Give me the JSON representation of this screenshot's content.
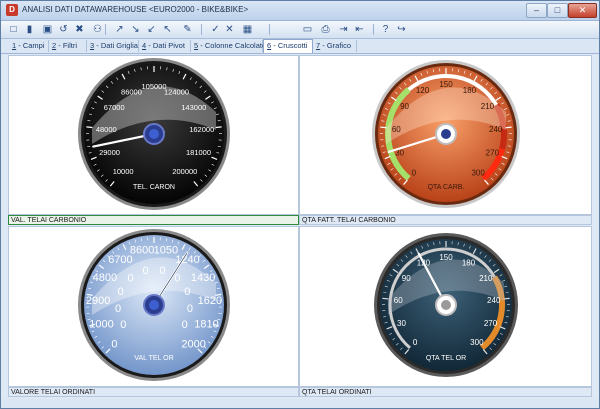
{
  "window": {
    "title": "ANALISI DATI DATAWAREHOUSE <EURO2000 - BIKE&BIKE>",
    "app_icon_glyph": "D"
  },
  "controls": {
    "minimize": "–",
    "maximize": "□",
    "close": "✕"
  },
  "toolbar": {
    "buttons": [
      {
        "name": "new-icon",
        "glyph": "□"
      },
      {
        "name": "open-icon",
        "glyph": "▮"
      },
      {
        "name": "save-icon",
        "glyph": "▣"
      },
      {
        "name": "undo-icon",
        "glyph": "↺"
      },
      {
        "name": "delete-icon",
        "glyph": "✖"
      },
      {
        "name": "find-icon",
        "glyph": "⚇"
      },
      {
        "name": "sort-asc-icon",
        "glyph": "↗"
      },
      {
        "name": "sort-desc-icon",
        "glyph": "↘"
      },
      {
        "name": "filter-icon",
        "glyph": "↙"
      },
      {
        "name": "arrow-icon",
        "glyph": "↖"
      },
      {
        "name": "edit-icon",
        "glyph": "✎"
      },
      {
        "name": "check-icon",
        "glyph": "✓"
      },
      {
        "name": "cross-icon",
        "glyph": "✕"
      },
      {
        "name": "layout-icon",
        "glyph": "▦"
      },
      {
        "name": "monitor-icon",
        "glyph": "▭"
      },
      {
        "name": "print-icon",
        "glyph": "⎙"
      },
      {
        "name": "export-icon",
        "glyph": "⇥"
      },
      {
        "name": "import-icon",
        "glyph": "⇤"
      },
      {
        "name": "help-icon",
        "glyph": "?"
      },
      {
        "name": "exit-icon",
        "glyph": "↪"
      }
    ]
  },
  "tabs": [
    {
      "num": "1",
      "label": " - Campi"
    },
    {
      "num": "2",
      "label": " - Filtri"
    },
    {
      "num": "3",
      "label": " - Dati Griglia"
    },
    {
      "num": "4",
      "label": " - Dati Pivot"
    },
    {
      "num": "5",
      "label": " - Colonne Calcolate"
    },
    {
      "num": "6",
      "label": " - Cruscotti"
    },
    {
      "num": "7",
      "label": " - Grafico"
    }
  ],
  "gauges": [
    {
      "caption": "VAL. TELAI CARBONIO",
      "unit_label": "TEL. CARON",
      "scale_labels": [
        "10000",
        "29000",
        "48000",
        "67000",
        "86000",
        "105000",
        "124000",
        "143000",
        "162000",
        "181000",
        "200000"
      ],
      "value": 36000,
      "min": 10000,
      "max": 200000
    },
    {
      "caption": "QTA FATT. TELAI CARBONIO",
      "unit_label": "QTA CARB.",
      "scale_labels": [
        "0",
        "30",
        "60",
        "90",
        "120",
        "150",
        "180",
        "210",
        "240",
        "270",
        "300"
      ],
      "value": 35,
      "min": 0,
      "max": 300
    },
    {
      "caption": "VALORE TELAI ORDINATI",
      "unit_label": "VAL TEL OR",
      "scale_labels": [
        "0",
        "1000",
        "2900",
        "4800",
        "6700",
        "8600",
        "1050",
        "1240",
        "1430",
        "1620",
        "1810",
        "2000"
      ],
      "zero_labels": [
        "0",
        "0",
        "0",
        "0",
        "0",
        "0",
        "0",
        "0",
        "0",
        "0"
      ],
      "value": 1240,
      "min": 0,
      "max": 2000
    },
    {
      "caption": "QTA TELAI ORDINATI",
      "unit_label": "QTA TEL OR",
      "scale_labels": [
        "0",
        "30",
        "60",
        "90",
        "120",
        "150",
        "180",
        "210",
        "240",
        "270",
        "300"
      ],
      "value": 120,
      "min": 0,
      "max": 300
    }
  ]
}
